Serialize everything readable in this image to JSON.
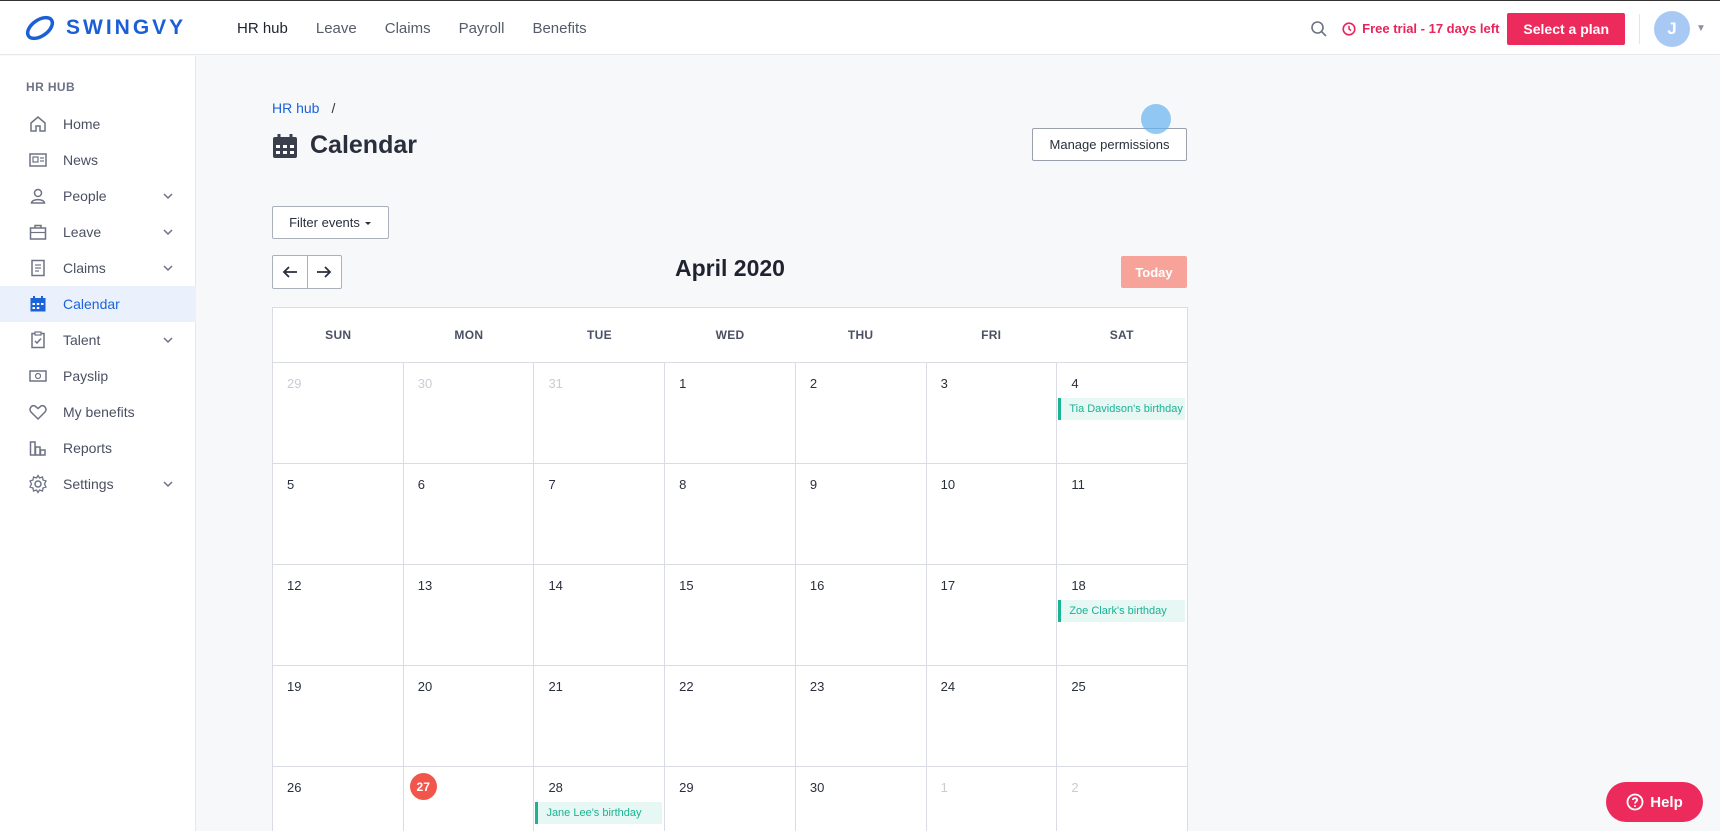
{
  "brand": {
    "name": "SWINGVY",
    "color": "#1a5fd6"
  },
  "topnav": [
    {
      "label": "HR hub",
      "active": true
    },
    {
      "label": "Leave"
    },
    {
      "label": "Claims"
    },
    {
      "label": "Payroll"
    },
    {
      "label": "Benefits"
    }
  ],
  "topbar": {
    "trial_text": "Free trial - 17 days left",
    "select_plan_label": "Select a plan",
    "avatar_initial": "J"
  },
  "sidebar": {
    "heading": "HR HUB",
    "items": [
      {
        "label": "Home",
        "icon": "home-icon"
      },
      {
        "label": "News",
        "icon": "news-icon"
      },
      {
        "label": "People",
        "icon": "person-icon",
        "expandable": true
      },
      {
        "label": "Leave",
        "icon": "briefcase-icon",
        "expandable": true
      },
      {
        "label": "Claims",
        "icon": "receipt-icon",
        "expandable": true
      },
      {
        "label": "Calendar",
        "icon": "calendar-icon",
        "active": true
      },
      {
        "label": "Talent",
        "icon": "clipboard-icon",
        "expandable": true
      },
      {
        "label": "Payslip",
        "icon": "money-icon"
      },
      {
        "label": "My benefits",
        "icon": "heart-icon"
      },
      {
        "label": "Reports",
        "icon": "reports-icon"
      },
      {
        "label": "Settings",
        "icon": "gear-icon",
        "expandable": true
      }
    ]
  },
  "breadcrumb": {
    "link": "HR hub",
    "separator": "/"
  },
  "page": {
    "title": "Calendar",
    "manage_permissions_label": "Manage permissions",
    "filter_label": "Filter events",
    "month_title": "April 2020",
    "today_label": "Today"
  },
  "calendar": {
    "weekdays": [
      "SUN",
      "MON",
      "TUE",
      "WED",
      "THU",
      "FRI",
      "SAT"
    ],
    "weeks": [
      [
        {
          "d": "29",
          "muted": true
        },
        {
          "d": "30",
          "muted": true
        },
        {
          "d": "31",
          "muted": true
        },
        {
          "d": "1"
        },
        {
          "d": "2"
        },
        {
          "d": "3"
        },
        {
          "d": "4",
          "event": "Tia Davidson's birthday"
        }
      ],
      [
        {
          "d": "5"
        },
        {
          "d": "6"
        },
        {
          "d": "7"
        },
        {
          "d": "8"
        },
        {
          "d": "9"
        },
        {
          "d": "10"
        },
        {
          "d": "11"
        }
      ],
      [
        {
          "d": "12"
        },
        {
          "d": "13"
        },
        {
          "d": "14"
        },
        {
          "d": "15"
        },
        {
          "d": "16"
        },
        {
          "d": "17"
        },
        {
          "d": "18",
          "event": "Zoe Clark's birthday"
        }
      ],
      [
        {
          "d": "19"
        },
        {
          "d": "20"
        },
        {
          "d": "21"
        },
        {
          "d": "22"
        },
        {
          "d": "23"
        },
        {
          "d": "24"
        },
        {
          "d": "25"
        }
      ],
      [
        {
          "d": "26"
        },
        {
          "d": "27",
          "today": true
        },
        {
          "d": "28",
          "event": "Jane Lee's birthday"
        },
        {
          "d": "29"
        },
        {
          "d": "30"
        },
        {
          "d": "1",
          "muted": true
        },
        {
          "d": "2",
          "muted": true
        }
      ]
    ]
  },
  "help_label": "Help",
  "colors": {
    "accent": "#ec2a5c",
    "link": "#1b63d8",
    "event": "#1ab394",
    "today": "#f2564a"
  }
}
